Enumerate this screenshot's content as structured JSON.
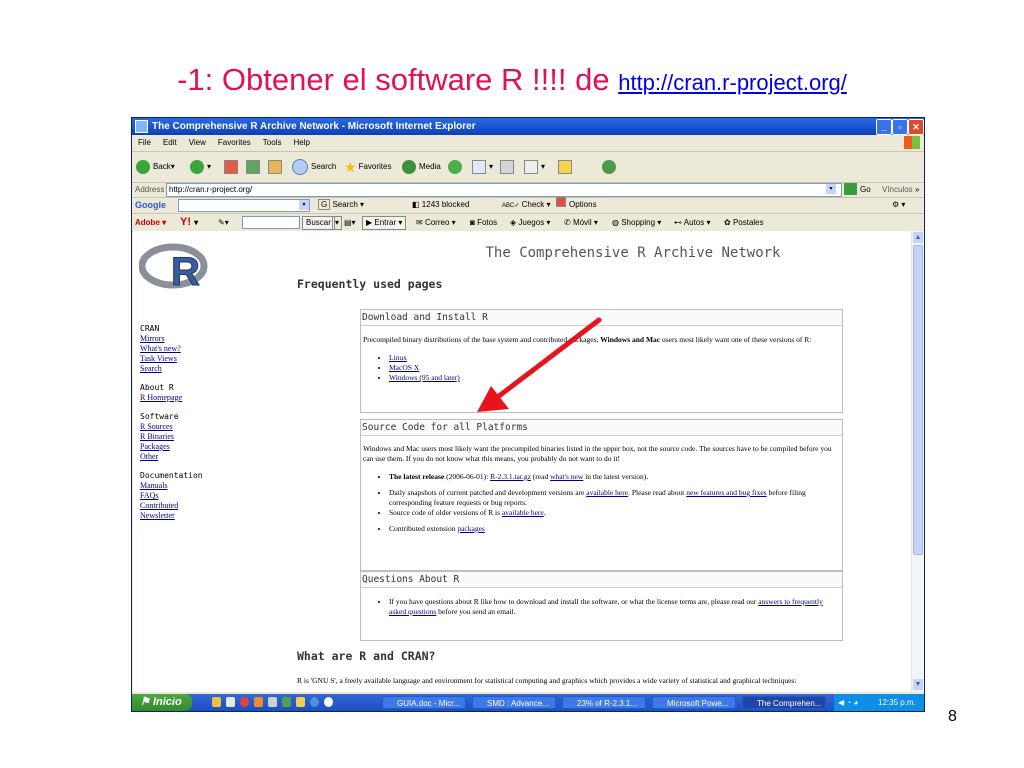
{
  "slide": {
    "title_text": "-1: Obtener el software R !!!! de",
    "title_link": "http://cran.r-project.org/",
    "page_number": "8"
  },
  "browser": {
    "title": "The Comprehensive R Archive Network - Microsoft Internet Explorer",
    "menu": [
      "File",
      "Edit",
      "View",
      "Favorites",
      "Tools",
      "Help"
    ],
    "toolbar": {
      "back": "Back",
      "search": "Search",
      "favorites": "Favorites",
      "media": "Media"
    },
    "address": {
      "label": "Address",
      "url": "http://cran.r-project.org/",
      "go": "Go",
      "links": "Vínculos"
    },
    "google_bar": {
      "logo": "Google",
      "search": "Search",
      "blocked": "1243 blocked",
      "check": "Check",
      "options": "Options"
    },
    "adobe_bar": {
      "adobe": "Adobe",
      "yahoo": "Y!",
      "buscar": "Buscar",
      "entrar": "Entrar",
      "correo": "Correo",
      "fotos": "Fotos",
      "juegos": "Juegos",
      "movil": "Móvil",
      "shopping": "Shopping",
      "autos": "Autos",
      "postales": "Postales"
    }
  },
  "page": {
    "main_title": "The Comprehensive R Archive Network",
    "frequently": "Frequently used pages",
    "sidebar": {
      "cran_head": "CRAN",
      "cran_links": [
        "Mirrors",
        "What's new?",
        "Task Views",
        "Search"
      ],
      "about_head": "About R",
      "about_links": [
        "R Homepage"
      ],
      "software_head": "Software",
      "software_links": [
        "R Sources",
        "R Binaries",
        "Packages",
        "Other"
      ],
      "doc_head": "Documentation",
      "doc_links": [
        "Manuals",
        "FAQs",
        "Contributed",
        "Newsletter"
      ]
    },
    "download": {
      "head": "Download and Install R",
      "text_a": "Precompiled binary distributions of the base system and contributed packages,",
      "text_bold": "Windows and Mac",
      "text_b": "users most likely want one of these versions of R:",
      "links": [
        "Linux",
        "MacOS X",
        "Windows (95 and later)"
      ]
    },
    "source": {
      "head": "Source Code for all Platforms",
      "text": "Windows and Mac users most likely want the precompiled binaries listed in the upper box, not the source code. The sources have to be compiled before you can use them. If you do not know what this means, you probably do not want to do it!",
      "latest_bold": "The latest release",
      "latest_date": "(2006-06-01):",
      "latest_file": "R-2.3.1.tar.gz",
      "latest_read": "(read",
      "latest_whatsnew": "what's new",
      "latest_tail": "in the latest version).",
      "daily_a": "Daily snapshots of current patched and development versions are",
      "daily_link1": "available here",
      "daily_b": ". Please read about",
      "daily_link2": "new features and bug fixes",
      "daily_c": "before filing corresponding feature requests or bug reports.",
      "older_a": "Source code of older versions of R is",
      "older_link": "available here",
      "older_b": ".",
      "contrib_a": "Contributed extension",
      "contrib_link": "packages"
    },
    "questions": {
      "head": "Questions About R",
      "text_a": "If you have questions about R like how to download and install the software, or what the license terms are, please read our",
      "text_link": "answers to frequently asked questions",
      "text_b": "before you send an email."
    },
    "what_head": "What are R and CRAN?",
    "what_text": "R is 'GNU S', a freely available language and environment for statistical computing and graphics which provides a wide variety of statistical and graphical techniques:"
  },
  "taskbar": {
    "start": "Inicio",
    "tasks": [
      "GUIA.doc - Micr...",
      "SMD : Advance...",
      "23% of R-2.3.1...",
      "Microsoft Powe...",
      "The Comprehen..."
    ],
    "clock": "12:35 p.m."
  },
  "colors": {
    "title": "#e0105a",
    "link": "#00008b",
    "arrow": "#e8141c",
    "xp_blue": "#245edb"
  }
}
